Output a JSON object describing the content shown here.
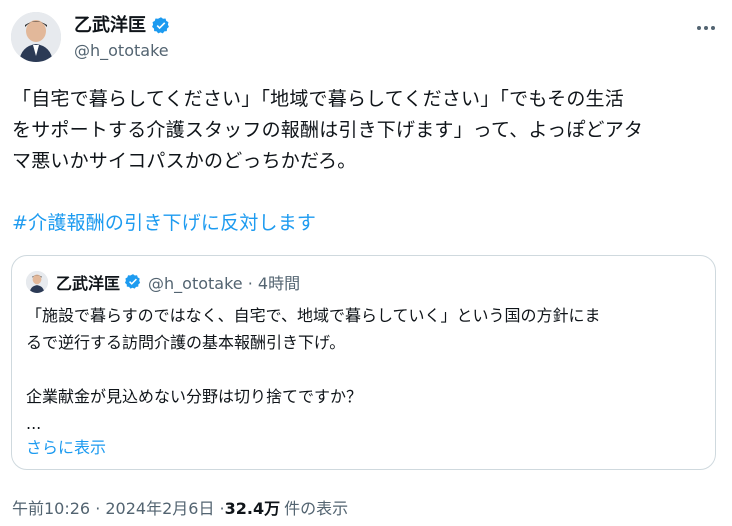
{
  "author": {
    "name": "乙武洋匡",
    "handle": "@h_ototake"
  },
  "tweet": {
    "text": "「自宅で暮らしてください」「地域で暮らしてください」「でもその生活\nをサポートする介護スタッフの報酬は引き下げます」って、よっぽどアタ\nマ悪いかサイコパスかのどっちかだろ。",
    "hashtag": "#介護報酬の引き下げに反対します"
  },
  "quote": {
    "name": "乙武洋匡",
    "meta": "@h_ototake · 4時間",
    "text": "「施設で暮らすのではなく、自宅で、地域で暮らしていく」という国の方針にま\nるで逆行する訪問介護の基本報酬引き下げ。\n\n企業献金が見込めない分野は切り捨てですか？\n...",
    "show_more": "さらに表示"
  },
  "footer": {
    "timestamp": "午前10:26 · 2024年2月6日 · ",
    "views": "32.4万",
    "views_label": "件の表示"
  },
  "colors": {
    "link": "#1d9bf0",
    "verified": "#1d9bf0",
    "secondary": "#536471"
  },
  "icons": {
    "verified": "verified-badge-icon",
    "more": "more-options-icon"
  }
}
